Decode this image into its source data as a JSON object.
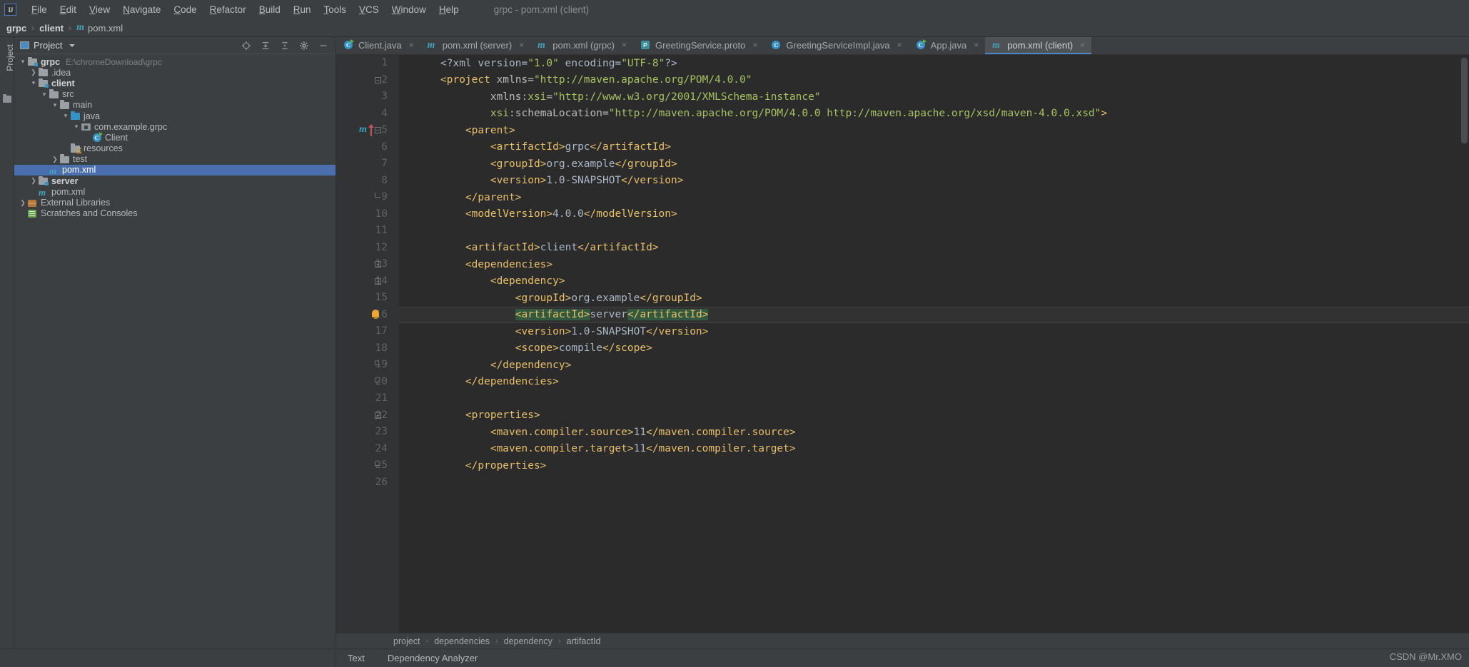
{
  "window": {
    "title": "grpc - pom.xml (client)",
    "logo_text": "IJ"
  },
  "menubar": {
    "items": [
      {
        "label": "File"
      },
      {
        "label": "Edit"
      },
      {
        "label": "View"
      },
      {
        "label": "Navigate"
      },
      {
        "label": "Code"
      },
      {
        "label": "Refactor"
      },
      {
        "label": "Build"
      },
      {
        "label": "Run"
      },
      {
        "label": "Tools"
      },
      {
        "label": "VCS"
      },
      {
        "label": "Window"
      },
      {
        "label": "Help"
      }
    ]
  },
  "navbar": {
    "crumbs": [
      "grpc",
      "client",
      "pom.xml"
    ],
    "separator": "›"
  },
  "toolstrip": {
    "project_tab": "Project"
  },
  "project_panel": {
    "title": "Project",
    "tools": [
      "locate-icon",
      "collapse-all-icon",
      "expand-icon",
      "settings-icon",
      "hide-icon"
    ],
    "tree": [
      {
        "label": "grpc",
        "path": "E:\\chromeDownload\\grpc",
        "indent": 0,
        "arrow": "down",
        "icon": "module-folder",
        "bold": true,
        "selected": false
      },
      {
        "label": ".idea",
        "path": "",
        "indent": 1,
        "arrow": "right",
        "icon": "folder",
        "bold": false,
        "selected": false
      },
      {
        "label": "client",
        "path": "",
        "indent": 1,
        "arrow": "down",
        "icon": "module-folder",
        "bold": true,
        "selected": false
      },
      {
        "label": "src",
        "path": "",
        "indent": 2,
        "arrow": "down",
        "icon": "folder",
        "bold": false,
        "selected": false
      },
      {
        "label": "main",
        "path": "",
        "indent": 3,
        "arrow": "down",
        "icon": "folder",
        "bold": false,
        "selected": false
      },
      {
        "label": "java",
        "path": "",
        "indent": 4,
        "arrow": "down",
        "icon": "source-folder",
        "bold": false,
        "selected": false
      },
      {
        "label": "com.example.grpc",
        "path": "",
        "indent": 5,
        "arrow": "down",
        "icon": "package",
        "bold": false,
        "selected": false
      },
      {
        "label": "Client",
        "path": "",
        "indent": 6,
        "arrow": "none",
        "icon": "runnable-class",
        "bold": false,
        "selected": false
      },
      {
        "label": "resources",
        "path": "",
        "indent": 4,
        "arrow": "none",
        "icon": "resource-folder",
        "bold": false,
        "selected": false
      },
      {
        "label": "test",
        "path": "",
        "indent": 3,
        "arrow": "right",
        "icon": "folder",
        "bold": false,
        "selected": false
      },
      {
        "label": "pom.xml",
        "path": "",
        "indent": 2,
        "arrow": "none",
        "icon": "maven",
        "bold": false,
        "selected": true
      },
      {
        "label": "server",
        "path": "",
        "indent": 1,
        "arrow": "right",
        "icon": "module-folder",
        "bold": true,
        "selected": false
      },
      {
        "label": "pom.xml",
        "path": "",
        "indent": 1,
        "arrow": "none",
        "icon": "maven",
        "bold": false,
        "selected": false
      },
      {
        "label": "External Libraries",
        "path": "",
        "indent": 0,
        "arrow": "right",
        "icon": "library",
        "bold": false,
        "selected": false
      },
      {
        "label": "Scratches and Consoles",
        "path": "",
        "indent": 0,
        "arrow": "none",
        "icon": "scratch",
        "bold": false,
        "selected": false
      }
    ]
  },
  "editor_tabs": [
    {
      "label": "Client.java",
      "icon": "runnable-class",
      "active": false,
      "close": "×"
    },
    {
      "label": "pom.xml (server)",
      "icon": "maven",
      "active": false,
      "close": "×"
    },
    {
      "label": "pom.xml (grpc)",
      "icon": "maven",
      "active": false,
      "close": "×"
    },
    {
      "label": "GreetingService.proto",
      "icon": "proto",
      "active": false,
      "close": "×"
    },
    {
      "label": "GreetingServiceImpl.java",
      "icon": "class",
      "active": false,
      "close": "×"
    },
    {
      "label": "App.java",
      "icon": "runnable-class",
      "active": false,
      "close": "×"
    },
    {
      "label": "pom.xml (client)",
      "icon": "maven",
      "active": true,
      "close": "×"
    }
  ],
  "editor": {
    "highlighted_line": 16,
    "gutter_markers": {
      "maven_line": 5,
      "bulb_line": 16
    },
    "lines": [
      {
        "n": 1,
        "fold": "",
        "tokens": [
          {
            "t": "<?xml version=",
            "c": "punct"
          },
          {
            "t": "\"1.0\"",
            "c": "attrv"
          },
          {
            "t": " encoding=",
            "c": "punct"
          },
          {
            "t": "\"UTF-8\"",
            "c": "attrv"
          },
          {
            "t": "?>",
            "c": "punct"
          }
        ]
      },
      {
        "n": 2,
        "fold": "start",
        "tokens": [
          {
            "t": "<project",
            "c": "tag"
          },
          {
            "t": " xmlns=",
            "c": "attr"
          },
          {
            "t": "\"http://maven.apache.org/POM/4.0.0\"",
            "c": "attrv"
          }
        ]
      },
      {
        "n": 3,
        "fold": "",
        "tokens": [
          {
            "t": "        xmlns:",
            "c": "attr"
          },
          {
            "t": "xsi",
            "c": "ns"
          },
          {
            "t": "=",
            "c": "attr"
          },
          {
            "t": "\"http://www.w3.org/2001/XMLSchema-instance\"",
            "c": "attrv"
          }
        ]
      },
      {
        "n": 4,
        "fold": "",
        "tokens": [
          {
            "t": "        ",
            "c": "attr"
          },
          {
            "t": "xsi",
            "c": "ns"
          },
          {
            "t": ":schemaLocation=",
            "c": "attr"
          },
          {
            "t": "\"http://maven.apache.org/POM/4.0.0 http://maven.apache.org/xsd/maven-4.0.0.xsd\"",
            "c": "attrv"
          },
          {
            "t": ">",
            "c": "tag"
          }
        ]
      },
      {
        "n": 5,
        "fold": "start",
        "tokens": [
          {
            "t": "    <parent>",
            "c": "tag"
          }
        ]
      },
      {
        "n": 6,
        "fold": "",
        "tokens": [
          {
            "t": "        <artifactId>",
            "c": "tag"
          },
          {
            "t": "grpc",
            "c": "text"
          },
          {
            "t": "</artifactId>",
            "c": "tag"
          }
        ]
      },
      {
        "n": 7,
        "fold": "",
        "tokens": [
          {
            "t": "        <groupId>",
            "c": "tag"
          },
          {
            "t": "org.example",
            "c": "text"
          },
          {
            "t": "</groupId>",
            "c": "tag"
          }
        ]
      },
      {
        "n": 8,
        "fold": "",
        "tokens": [
          {
            "t": "        <version>",
            "c": "tag"
          },
          {
            "t": "1.0-SNAPSHOT",
            "c": "text"
          },
          {
            "t": "</version>",
            "c": "tag"
          }
        ]
      },
      {
        "n": 9,
        "fold": "end",
        "tokens": [
          {
            "t": "    </parent>",
            "c": "tag"
          }
        ]
      },
      {
        "n": 10,
        "fold": "",
        "tokens": [
          {
            "t": "    <modelVersion>",
            "c": "tag"
          },
          {
            "t": "4.0.0",
            "c": "text"
          },
          {
            "t": "</modelVersion>",
            "c": "tag"
          }
        ]
      },
      {
        "n": 11,
        "fold": "",
        "tokens": []
      },
      {
        "n": 12,
        "fold": "",
        "tokens": [
          {
            "t": "    <artifactId>",
            "c": "tag"
          },
          {
            "t": "client",
            "c": "text"
          },
          {
            "t": "</artifactId>",
            "c": "tag"
          }
        ]
      },
      {
        "n": 13,
        "fold": "start",
        "tokens": [
          {
            "t": "    <dependencies>",
            "c": "tag"
          }
        ]
      },
      {
        "n": 14,
        "fold": "start",
        "tokens": [
          {
            "t": "        <dependency>",
            "c": "tag"
          }
        ]
      },
      {
        "n": 15,
        "fold": "",
        "tokens": [
          {
            "t": "            <groupId>",
            "c": "tag"
          },
          {
            "t": "org.example",
            "c": "text"
          },
          {
            "t": "</groupId>",
            "c": "tag"
          }
        ]
      },
      {
        "n": 16,
        "fold": "",
        "tokens": [
          {
            "t": "            ",
            "c": "tag"
          },
          {
            "t": "<artifactId>",
            "c": "tag-hl"
          },
          {
            "t": "server",
            "c": "text"
          },
          {
            "t": "</artifactId>",
            "c": "tag-hl"
          }
        ]
      },
      {
        "n": 17,
        "fold": "",
        "tokens": [
          {
            "t": "            <version>",
            "c": "tag"
          },
          {
            "t": "1.0-SNAPSHOT",
            "c": "text"
          },
          {
            "t": "</version>",
            "c": "tag"
          }
        ]
      },
      {
        "n": 18,
        "fold": "",
        "tokens": [
          {
            "t": "            <scope>",
            "c": "tag"
          },
          {
            "t": "compile",
            "c": "text"
          },
          {
            "t": "</scope>",
            "c": "tag"
          }
        ]
      },
      {
        "n": 19,
        "fold": "end",
        "tokens": [
          {
            "t": "        </dependency>",
            "c": "tag"
          }
        ]
      },
      {
        "n": 20,
        "fold": "end",
        "tokens": [
          {
            "t": "    </dependencies>",
            "c": "tag"
          }
        ]
      },
      {
        "n": 21,
        "fold": "",
        "tokens": []
      },
      {
        "n": 22,
        "fold": "start",
        "tokens": [
          {
            "t": "    <properties>",
            "c": "tag"
          }
        ]
      },
      {
        "n": 23,
        "fold": "",
        "tokens": [
          {
            "t": "        <maven.compiler.source>",
            "c": "tag"
          },
          {
            "t": "11",
            "c": "text"
          },
          {
            "t": "</maven.compiler.source>",
            "c": "tag"
          }
        ]
      },
      {
        "n": 24,
        "fold": "",
        "tokens": [
          {
            "t": "        <maven.compiler.target>",
            "c": "tag"
          },
          {
            "t": "11",
            "c": "text"
          },
          {
            "t": "</maven.compiler.target>",
            "c": "tag"
          }
        ]
      },
      {
        "n": 25,
        "fold": "end",
        "tokens": [
          {
            "t": "    </properties>",
            "c": "tag"
          }
        ]
      },
      {
        "n": 26,
        "fold": "",
        "tokens": []
      }
    ]
  },
  "editor_breadcrumbs": {
    "crumbs": [
      "project",
      "dependencies",
      "dependency",
      "artifactId"
    ],
    "separator": "›"
  },
  "statusbar": {
    "items": [
      "Text",
      "Dependency Analyzer"
    ],
    "watermark": "CSDN @Mr.XMO"
  },
  "colors": {
    "accent": "#4b6eaf",
    "tag": "#e8bf6a",
    "string": "#a5c261",
    "text": "#a9b7c6",
    "bg_editor": "#2b2b2b",
    "bg_panel": "#3c3f41",
    "bg_gutter": "#313335"
  }
}
